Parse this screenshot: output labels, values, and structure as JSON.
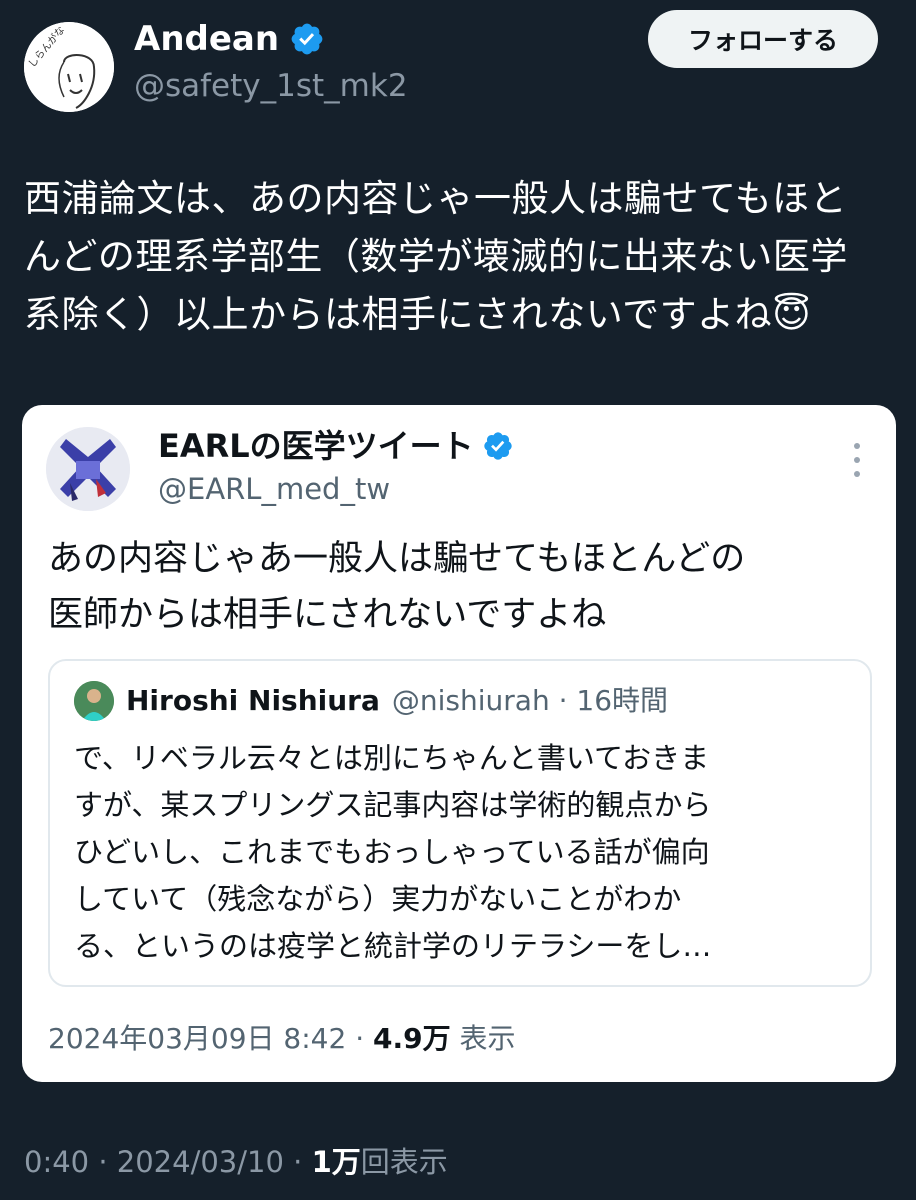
{
  "author": {
    "name": "Andean",
    "handle": "@safety_1st_mk2",
    "verified": true,
    "avatar_text": "しらんがな"
  },
  "follow_button": {
    "label": "フォローする"
  },
  "tweet": {
    "text": "西浦論文は、あの内容じゃ一般人は騙せてもほと\nんどの理系学部生（数学が壊滅的に出来ない医学\n系除く）以上からは相手にされないですよね😇"
  },
  "quote": {
    "name": "EARLの医学ツイート",
    "handle": "@EARL_med_tw",
    "verified": true,
    "text": "あの内容じゃあ一般人は騙せてもほとんどの\n医師からは相手にされないですよね",
    "nested": {
      "name": "Hiroshi Nishiura",
      "meta": "@nishiurah · 16時間",
      "text": "で、リベラル云々とは別にちゃんと書いておきま\nすが、某スプリングス記事内容は学術的観点から\nひどいし、これまでもおっしゃっている話が偏向\nしていて（残念ながら）実力がないことがわか\nる、というのは疫学と統計学のリテラシーをし…"
    },
    "timestamp": "2024年03月09日 8:42 · ",
    "views_count": "4.9万",
    "views_label": " 表示"
  },
  "footer": {
    "time": "0:40 · 2024/03/10 · ",
    "views_count": "1万",
    "views_label": "回表示"
  },
  "colors": {
    "background": "#15202b",
    "verified_blue": "#1d9bf0",
    "secondary_text": "#8b98a5"
  }
}
